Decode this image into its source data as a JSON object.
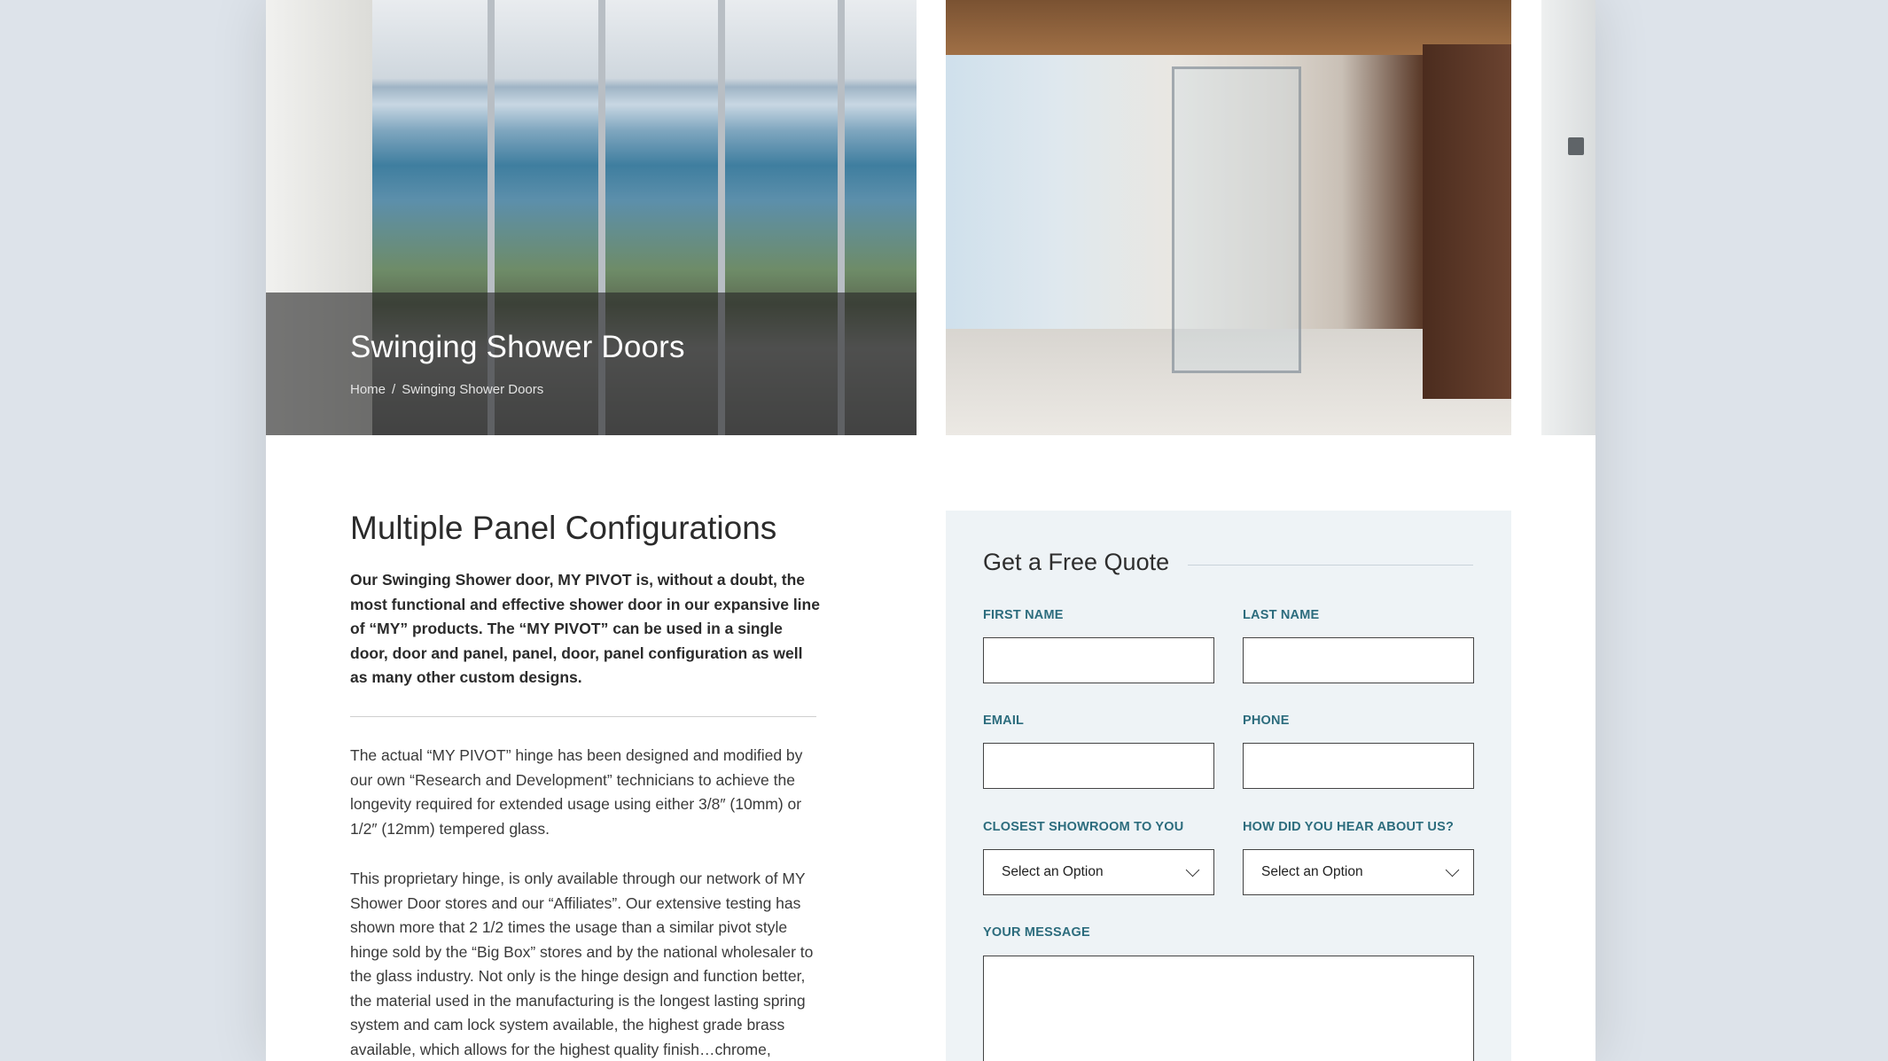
{
  "hero": {
    "title": "Swinging Shower Doors",
    "breadcrumb": {
      "home": "Home",
      "separator": "/",
      "current": "Swinging Shower Doors"
    }
  },
  "content": {
    "title": "Multiple Panel Configurations",
    "lead": "Our Swinging Shower door, MY PIVOT is, without a doubt, the most functional and effective shower door in our expansive line of “MY” products. The “MY PIVOT” can be used in a single door, door and panel, panel, door, panel configuration as well as many other custom designs.",
    "paragraph_1": "The actual “MY PIVOT” hinge has been designed and modified by our own “Research and Development” technicians to achieve the longevity required for extended usage using either 3/8″ (10mm) or 1/2″ (12mm) tempered glass.",
    "paragraph_2": "This proprietary hinge, is only available through our network of MY Shower Door stores and our “Affiliates”. Our extensive testing has shown more that 2 1/2 times the usage than a similar pivot style hinge sold by the “Big Box” stores and by the national wholesaler to the glass industry. Not only is the hinge design and function better, the material used in the manufacturing is the longest lasting spring system and cam lock system available, the highest grade brass available, which allows for the highest quality finish…chrome,"
  },
  "quote_form": {
    "title": "Get a Free Quote",
    "first_name_label": "FIRST NAME",
    "last_name_label": "LAST NAME",
    "email_label": "EMAIL",
    "phone_label": "PHONE",
    "showroom_label": "CLOSEST SHOWROOM TO YOU",
    "showroom_value": "Select an Option",
    "hear_label": "HOW DID YOU HEAR ABOUT US?",
    "hear_value": "Select an Option",
    "message_label": "YOUR MESSAGE"
  },
  "icons": {
    "select_chevron": "chevron-down-icon"
  },
  "colors": {
    "label_accent": "#2c6c7d",
    "form_background": "#eef3f6",
    "page_background": "#dde3ea"
  }
}
